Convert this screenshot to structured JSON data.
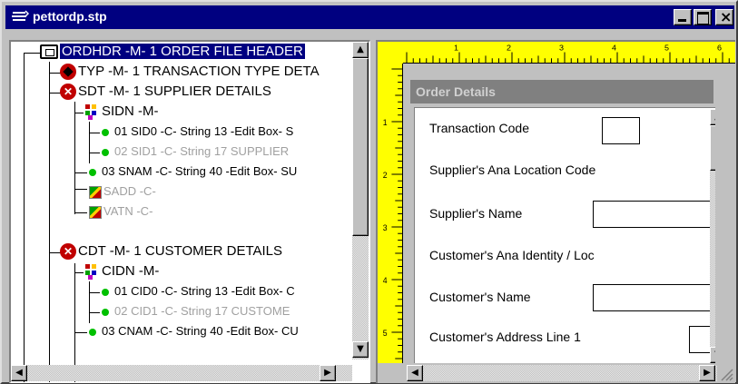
{
  "window": {
    "title": "pettordp.stp"
  },
  "tree": {
    "items": [
      {
        "label": "ORDHDR -M- 1 ORDER FILE HEADER",
        "icon": "table-icon",
        "selected": true
      },
      {
        "label": "TYP -M- 1 TRANSACTION TYPE DETA",
        "icon": "red-diamond-icon"
      },
      {
        "label": "SDT -M- 1 SUPPLIER DETAILS",
        "icon": "red-x-icon"
      },
      {
        "label": "SIDN -M-",
        "icon": "dots-icon"
      },
      {
        "label": "01 SID0 -C- String 13 -Edit Box- S",
        "icon": "green-dot-icon"
      },
      {
        "label": "02 SID1 -C- String 17 SUPPLIER",
        "icon": "green-dot-icon",
        "disabled": true
      },
      {
        "label": "03 SNAM -C- String 40 -Edit Box- SU",
        "icon": "green-dot-icon"
      },
      {
        "label": "SADD -C-",
        "icon": "flag-icon",
        "disabled": true
      },
      {
        "label": "VATN -C-",
        "icon": "flag-icon",
        "disabled": true
      },
      {
        "label": "CDT -M- 1 CUSTOMER DETAILS",
        "icon": "red-x-icon"
      },
      {
        "label": "CIDN -M-",
        "icon": "dots-icon"
      },
      {
        "label": "01 CID0 -C- String 13 -Edit Box- C",
        "icon": "green-dot-icon"
      },
      {
        "label": "02 CID1 -C- String 17 CUSTOME",
        "icon": "green-dot-icon",
        "disabled": true
      },
      {
        "label": "03 CNAM -C- String 40 -Edit Box- CU",
        "icon": "green-dot-icon"
      }
    ]
  },
  "ruler": {
    "marks": [
      "1",
      "2",
      "3",
      "4",
      "5",
      "6"
    ],
    "vmarks": [
      "1",
      "2",
      "3",
      "4",
      "5"
    ]
  },
  "form": {
    "title": "Order Details",
    "fields": [
      {
        "label": "Transaction Code"
      },
      {
        "label": "Supplier's Ana Location Code"
      },
      {
        "label": "Supplier's Name"
      },
      {
        "label": "Customer's Ana Identity / Loc"
      },
      {
        "label": "Customer's Name"
      },
      {
        "label": "Customer's Address Line 1"
      }
    ]
  },
  "colors": {
    "titlebar": "#000080",
    "ruler": "#ffff00",
    "selection": "#000080"
  }
}
